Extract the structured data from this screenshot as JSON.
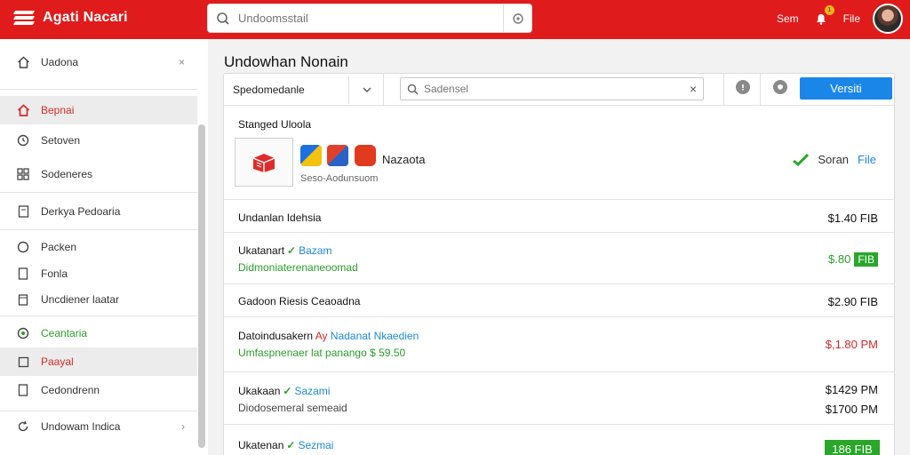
{
  "header": {
    "logo_text": "Agati Nacari",
    "search_placeholder": "Undoomsstail",
    "user_name": "Sem",
    "notification_count": "1",
    "file_label": "File"
  },
  "sidebar": {
    "items": [
      {
        "label": "Uadona",
        "trail": "×"
      },
      {
        "label": "Bepnai"
      },
      {
        "label": "Setoven"
      },
      {
        "label": "Sodeneres"
      },
      {
        "label": "Derkya Pedoaria"
      },
      {
        "label": "Packen"
      },
      {
        "label": "Fonla"
      },
      {
        "label": "Uncdiener laatar"
      },
      {
        "label": "Ceantaria"
      },
      {
        "label": "Paayal"
      },
      {
        "label": "Cedondrenn"
      },
      {
        "label": "Undowam Indica",
        "trail": "›"
      }
    ]
  },
  "main": {
    "title": "Undowhan Nonain",
    "toolbar": {
      "select_value": "Spedomedanle",
      "filter_placeholder": "Sadensel",
      "primary_label": "Versiti"
    },
    "section_header": "Stanged Uloola",
    "brand": {
      "name": "Nazaota",
      "sub": "Seso-Aodunsuom",
      "action_text": "Soran",
      "action_link": "File"
    },
    "rows": [
      {
        "title": "Undanlan Idehsia",
        "price": "$1.40 FIB"
      },
      {
        "title": "Ukatanart",
        "title_link": "Bazam",
        "sub": "Didmoniaterenaneoomad",
        "price": "$.80",
        "price_tag": "FIB"
      },
      {
        "title": "Gadoon Riesis Ceaoadna",
        "price": "$2.90 FIB"
      },
      {
        "title": "Datoindusakern",
        "title_red": "Ay",
        "title_link": "Nadanat Nkaedien",
        "sub": "Umfaspnenaer lat panango",
        "sub_amount": "$ 59.50",
        "price": "$,1.80 PM"
      },
      {
        "title": "Ukakaan",
        "title_link": "Sazami",
        "sub": "Diodosemeral semeaid",
        "price": "$1429 PM",
        "price2": "$1700 PM"
      },
      {
        "title": "Ukatenan",
        "title_link": "Sezmai",
        "price": "186 FIB"
      }
    ]
  },
  "colors": {
    "brand_red": "#e01b1b",
    "accent_blue": "#1a86e8",
    "success_green": "#2aa62a"
  }
}
